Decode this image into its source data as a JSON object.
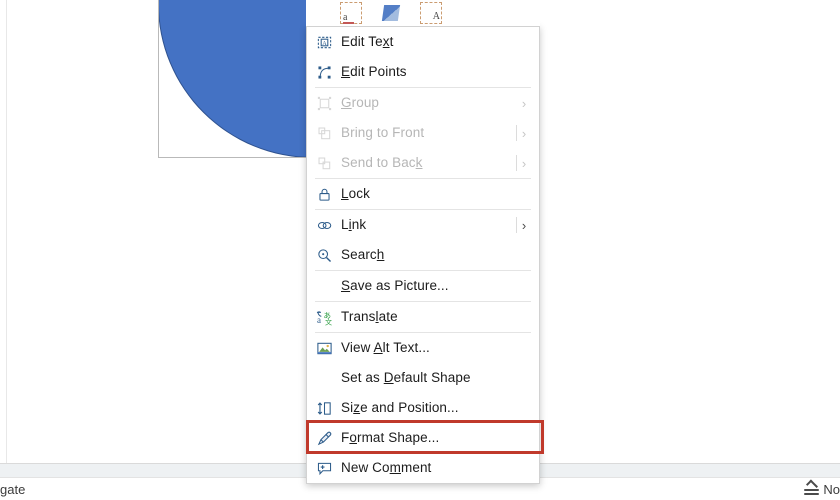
{
  "app": {
    "context": "powerpoint-shape-context-menu"
  },
  "slide": {
    "shape": {
      "name": "oval-shape",
      "fill_color": "#4472C4",
      "outline_color": "#2F528F",
      "selected": true,
      "handle_count": 2
    }
  },
  "mini_toolbar": {
    "icons": [
      {
        "name": "replace-text-icon",
        "glyph": "a"
      },
      {
        "name": "format-painter-icon",
        "glyph": ""
      },
      {
        "name": "text-box-icon",
        "glyph": "A"
      }
    ]
  },
  "context_menu": {
    "items": [
      {
        "id": "edit-text",
        "label": "Edit Text",
        "accel": "x",
        "icon": "edit-text-icon",
        "disabled": false,
        "submenu": false,
        "separator_after": false
      },
      {
        "id": "edit-points",
        "label": "Edit Points",
        "accel": "E",
        "icon": "edit-points-icon",
        "disabled": false,
        "submenu": false,
        "separator_after": true
      },
      {
        "id": "group",
        "label": "Group",
        "accel": "G",
        "icon": "group-icon",
        "disabled": true,
        "submenu": true,
        "separator_after": false
      },
      {
        "id": "bring-to-front",
        "label": "Bring to Front",
        "accel": "R",
        "icon": "bring-to-front-icon",
        "disabled": true,
        "submenu": true,
        "separator_after": false
      },
      {
        "id": "send-to-back",
        "label": "Send to Back",
        "accel": "k",
        "icon": "send-to-back-icon",
        "disabled": true,
        "submenu": true,
        "separator_after": true
      },
      {
        "id": "lock",
        "label": "Lock",
        "accel": "L",
        "icon": "lock-icon",
        "disabled": false,
        "submenu": false,
        "separator_after": true
      },
      {
        "id": "link",
        "label": "Link",
        "accel": "i",
        "icon": "link-icon",
        "disabled": false,
        "submenu": true,
        "separator_after": false
      },
      {
        "id": "search",
        "label": "Search",
        "accel": "h",
        "icon": "search-icon",
        "disabled": false,
        "submenu": false,
        "separator_after": true
      },
      {
        "id": "save-as-picture",
        "label": "Save as Picture...",
        "accel": "S",
        "icon": "none",
        "disabled": false,
        "submenu": false,
        "separator_after": true
      },
      {
        "id": "translate",
        "label": "Translate",
        "accel": "l",
        "icon": "translate-icon",
        "disabled": false,
        "submenu": false,
        "separator_after": true
      },
      {
        "id": "view-alt-text",
        "label": "View Alt Text...",
        "accel": "A",
        "icon": "view-alt-text-icon",
        "disabled": false,
        "submenu": false,
        "separator_after": false
      },
      {
        "id": "set-default-shape",
        "label": "Set as Default Shape",
        "accel": "D",
        "icon": "none",
        "disabled": false,
        "submenu": false,
        "separator_after": false
      },
      {
        "id": "size-and-position",
        "label": "Size and Position...",
        "accel": "z",
        "icon": "size-position-icon",
        "disabled": false,
        "submenu": false,
        "separator_after": false
      },
      {
        "id": "format-shape",
        "label": "Format Shape...",
        "accel": "o",
        "icon": "format-shape-icon",
        "disabled": false,
        "submenu": false,
        "separator_after": false
      },
      {
        "id": "new-comment",
        "label": "New Comment",
        "accel": "m",
        "icon": "new-comment-icon",
        "disabled": false,
        "submenu": false,
        "separator_after": false
      }
    ]
  },
  "annotation": {
    "target": "format-shape",
    "color": "#C0392B"
  },
  "status_bar": {
    "left_text": "gate",
    "notes_label": "No",
    "notes_icon": "notes-caret-icon"
  }
}
